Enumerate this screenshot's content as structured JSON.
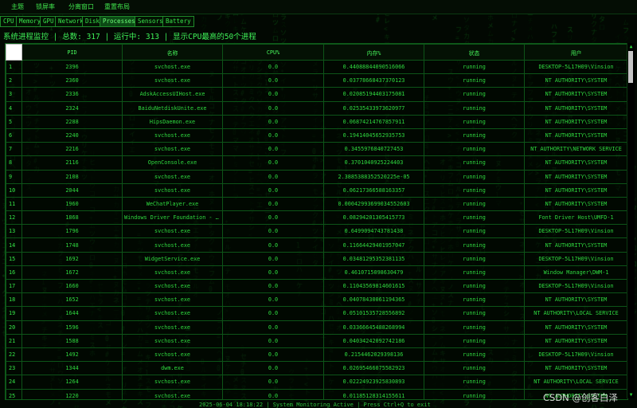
{
  "menu": [
    "主题",
    "锁屏率",
    "分离窗口",
    "重置布局"
  ],
  "tabs": [
    {
      "label": "CPU",
      "active": false
    },
    {
      "label": "Memory",
      "active": false
    },
    {
      "label": "GPU",
      "active": false
    },
    {
      "label": "Network",
      "active": false
    },
    {
      "label": "Disk",
      "active": false
    },
    {
      "label": "Processes",
      "active": true
    },
    {
      "label": "Sensors",
      "active": false
    },
    {
      "label": "Battery",
      "active": false
    }
  ],
  "status_line": "系统进程监控 | 总数: 317 | 运行中: 313 | 显示CPU最高的50个进程",
  "table": {
    "columns": [
      "PID",
      "名称",
      "CPU%",
      "内存%",
      "状态",
      "用户"
    ],
    "rows": [
      [
        "1",
        "2396",
        "svchost.exe",
        "0.0",
        "0.44088844090516066",
        "running",
        "DESKTOP-5L17H09\\Vinsion"
      ],
      [
        "2",
        "2360",
        "svchost.exe",
        "0.0",
        "0.03778668437370123",
        "running",
        "NT AUTHORITY\\SYSTEM"
      ],
      [
        "3",
        "2336",
        "AdskAccessUIHost.exe",
        "0.0",
        "0.02085194403175081",
        "running",
        "NT AUTHORITY\\SYSTEM"
      ],
      [
        "4",
        "2324",
        "BaiduNetdiskUnite.exe",
        "0.0",
        "0.02535433973620977",
        "running",
        "NT AUTHORITY\\SYSTEM"
      ],
      [
        "5",
        "2288",
        "HipsDaemon.exe",
        "0.0",
        "0.06874214767857911",
        "running",
        "NT AUTHORITY\\SYSTEM"
      ],
      [
        "6",
        "2240",
        "svchost.exe",
        "0.0",
        "0.19414045652935753",
        "running",
        "NT AUTHORITY\\SYSTEM"
      ],
      [
        "7",
        "2216",
        "svchost.exe",
        "0.0",
        "0.3455976840727453",
        "running",
        "NT AUTHORITY\\NETWORK SERVICE"
      ],
      [
        "8",
        "2116",
        "OpenConsole.exe",
        "0.0",
        "0.3701040925224403",
        "running",
        "NT AUTHORITY\\SYSTEM"
      ],
      [
        "9",
        "2108",
        "svchost.exe",
        "0.0",
        "2.3885388352520225e-05",
        "running",
        "NT AUTHORITY\\SYSTEM"
      ],
      [
        "10",
        "2044",
        "svchost.exe",
        "0.0",
        "0.06217366588163357",
        "running",
        "NT AUTHORITY\\SYSTEM"
      ],
      [
        "11",
        "1960",
        "WeChatPlayer.exe",
        "0.0",
        "0.00042993699034552603",
        "running",
        "NT AUTHORITY\\SYSTEM"
      ],
      [
        "12",
        "1868",
        "Windows Driver Foundation - User-mode Driver Framework Host Process",
        "0.0",
        "0.08294201305415773",
        "running",
        "Font Driver Host\\UMFD-1"
      ],
      [
        "13",
        "1796",
        "svchost.exe",
        "0.0",
        "0.6499094743781438",
        "running",
        "DESKTOP-5L17H09\\Vinsion"
      ],
      [
        "14",
        "1748",
        "svchost.exe",
        "0.0",
        "0.11664429401957047",
        "running",
        "NT AUTHORITY\\SYSTEM"
      ],
      [
        "15",
        "1692",
        "WidgetService.exe",
        "0.0",
        "0.03481295352381135",
        "running",
        "DESKTOP-5L17H09\\Vinsion"
      ],
      [
        "16",
        "1672",
        "svchost.exe",
        "0.0",
        "0.4610715098630479",
        "running",
        "Window Manager\\DWM-1"
      ],
      [
        "17",
        "1660",
        "svchost.exe",
        "0.0",
        "0.11043569814601615",
        "running",
        "DESKTOP-5L17H09\\Vinsion"
      ],
      [
        "18",
        "1652",
        "svchost.exe",
        "0.0",
        "0.04078430061194365",
        "running",
        "NT AUTHORITY\\SYSTEM"
      ],
      [
        "19",
        "1644",
        "svchost.exe",
        "0.0",
        "0.05101535728556892",
        "running",
        "NT AUTHORITY\\LOCAL SERVICE"
      ],
      [
        "20",
        "1596",
        "svchost.exe",
        "0.0",
        "0.03366645488268994",
        "running",
        "NT AUTHORITY\\SYSTEM"
      ],
      [
        "21",
        "1588",
        "svchost.exe",
        "0.0",
        "0.04034242092742186",
        "running",
        "NT AUTHORITY\\SYSTEM"
      ],
      [
        "22",
        "1492",
        "svchost.exe",
        "0.0",
        "0.2154462029398136",
        "running",
        "DESKTOP-5L17H09\\Vinsion"
      ],
      [
        "23",
        "1344",
        "dwm.exe",
        "0.0",
        "0.02695466075582923",
        "running",
        "NT AUTHORITY\\SYSTEM"
      ],
      [
        "24",
        "1264",
        "svchost.exe",
        "0.0",
        "0.02224923925830893",
        "running",
        "NT AUTHORITY\\LOCAL SERVICE"
      ],
      [
        "25",
        "1220",
        "svchost.exe",
        "0.0",
        "0.01185128314155611",
        "running",
        "NT AUTHORITY\\SYSTEM"
      ]
    ]
  },
  "footer": "2025-06-04 18:18:22 | System Monitoring Active | Press Ctrl+Q to exit",
  "watermark": "CSDN @创客白泽",
  "colors": {
    "accent": "#22e33a",
    "background": "#020802",
    "active_tab": "#0c4a15"
  }
}
